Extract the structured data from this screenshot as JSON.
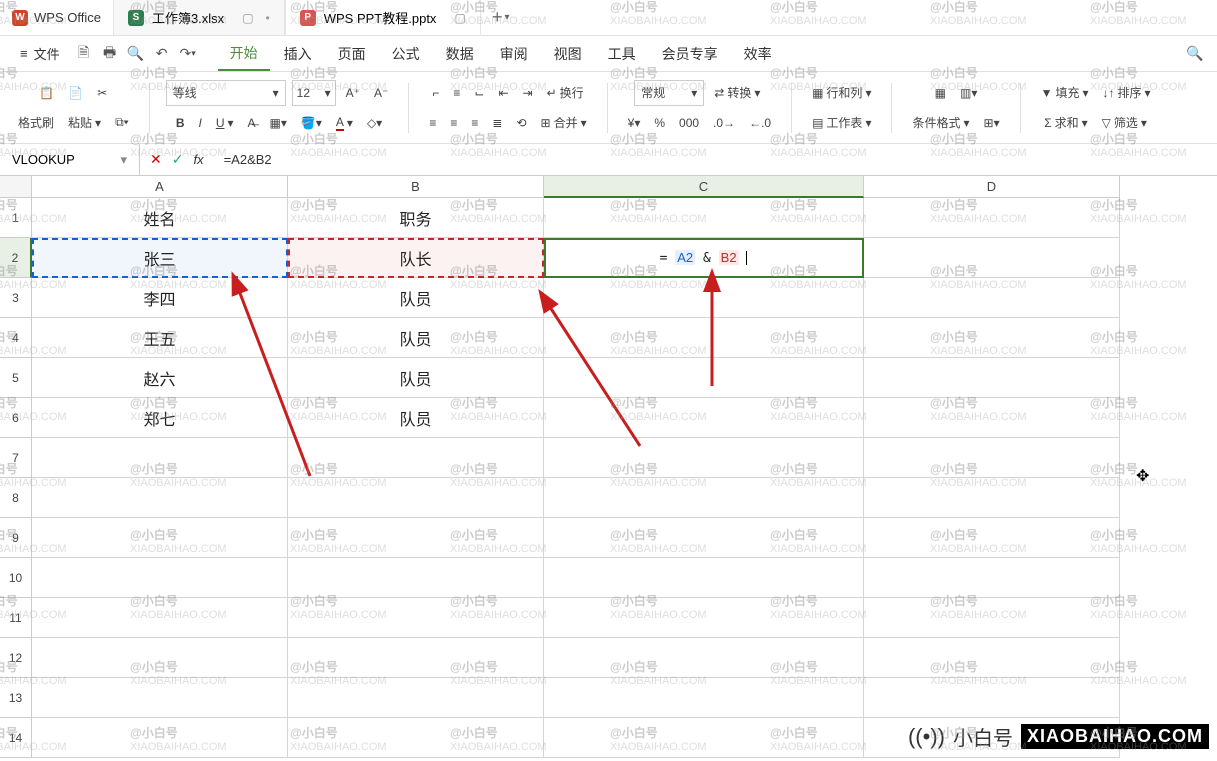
{
  "app": {
    "name": "WPS Office"
  },
  "tabs": [
    {
      "label": "工作簿3.xlsx",
      "icon": "S",
      "active": true
    },
    {
      "label": "WPS PPT教程.pptx",
      "icon": "P",
      "active": false
    }
  ],
  "menu": {
    "file": "文件",
    "items": [
      "开始",
      "插入",
      "页面",
      "公式",
      "数据",
      "审阅",
      "视图",
      "工具",
      "会员专享",
      "效率"
    ],
    "active_index": 0
  },
  "ribbon": {
    "format_painter": "格式刷",
    "paste": "粘贴",
    "font_name": "等线",
    "font_size": "12",
    "wrap": "换行",
    "merge": "合并",
    "number_format": "常规",
    "convert": "转换",
    "rowcol": "行和列",
    "worksheet": "工作表",
    "cond_format": "条件格式",
    "fill": "填充",
    "sum": "求和",
    "sort": "排序",
    "filter": "筛选"
  },
  "namebox": "VLOOKUP",
  "formula": "=A2&B2",
  "columns": [
    "A",
    "B",
    "C",
    "D"
  ],
  "rows_count": 14,
  "active_row": 2,
  "active_col": "C",
  "data": {
    "A1": "姓名",
    "B1": "职务",
    "A2": "张三",
    "B2": "队长",
    "A3": "李四",
    "B3": "队员",
    "A4": "王五",
    "B4": "队员",
    "A5": "赵六",
    "B5": "队员",
    "A6": "郑七",
    "B6": "队员"
  },
  "edit_cell": {
    "ref": "C2",
    "parts": {
      "eq": "= ",
      "a": "A2",
      "amp": " & ",
      "b": "B2"
    }
  },
  "watermark": {
    "line1": "@小白号",
    "line2": "XIAOBAIHAO.COM",
    "badge_text": "小白号",
    "badge_box": "XIAOBAIHAO.COM"
  }
}
